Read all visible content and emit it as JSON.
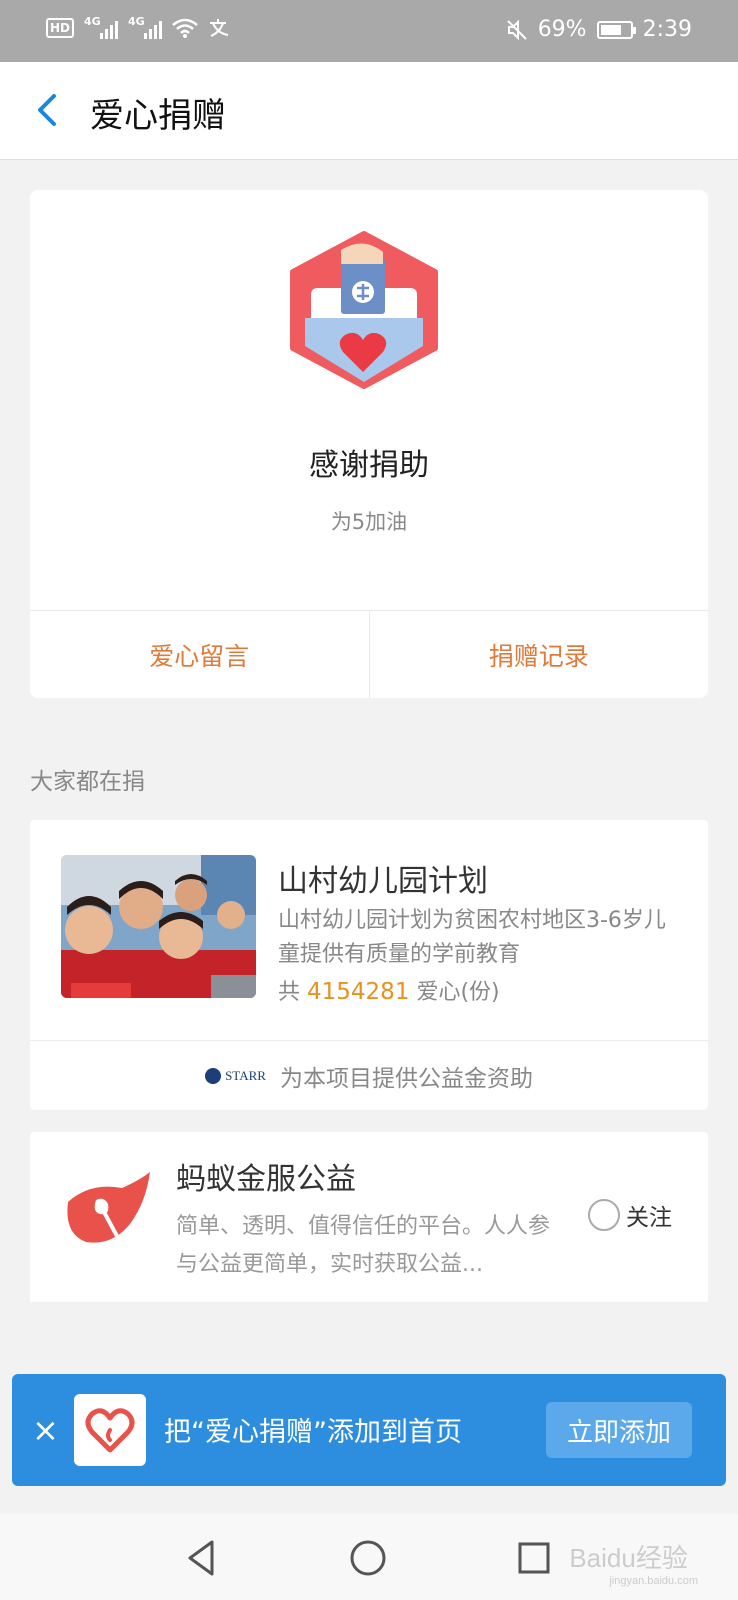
{
  "status_bar": {
    "hd": "HD",
    "net1": "4G",
    "net2": "4G",
    "battery": "69%",
    "time": "2:39"
  },
  "header": {
    "title": "爱心捐赠"
  },
  "thanks_card": {
    "title": "感谢捐助",
    "subtitle": "为5加油",
    "left_action": "爱心留言",
    "right_action": "捐赠记录"
  },
  "section": {
    "label": "大家都在捐"
  },
  "project": {
    "title": "山村幼儿园计划",
    "desc": "山村幼儿园计划为贫困农村地区3-6岁儿童提供有质量的学前教育",
    "count_prefix": "共",
    "count": "4154281",
    "count_suffix": "爱心(份)",
    "sponsor_logo": "STARR",
    "sponsor_text": "为本项目提供公益金资助"
  },
  "ant": {
    "name": "蚂蚁金服公益",
    "desc": "简单、透明、值得信任的平台。人人参与公益更简单，实时获取公益...",
    "follow_label": "关注"
  },
  "banner": {
    "close": "×",
    "text": "把“爱心捐赠”添加到首页",
    "button": "立即添加"
  },
  "watermark": {
    "text": "Baidu经验",
    "sub": "jingyan.baidu.com"
  },
  "colors": {
    "accent_orange": "#e07a3a",
    "count_orange": "#e6921e",
    "banner_blue": "#2d8ee0",
    "back_blue": "#1a88d8"
  }
}
